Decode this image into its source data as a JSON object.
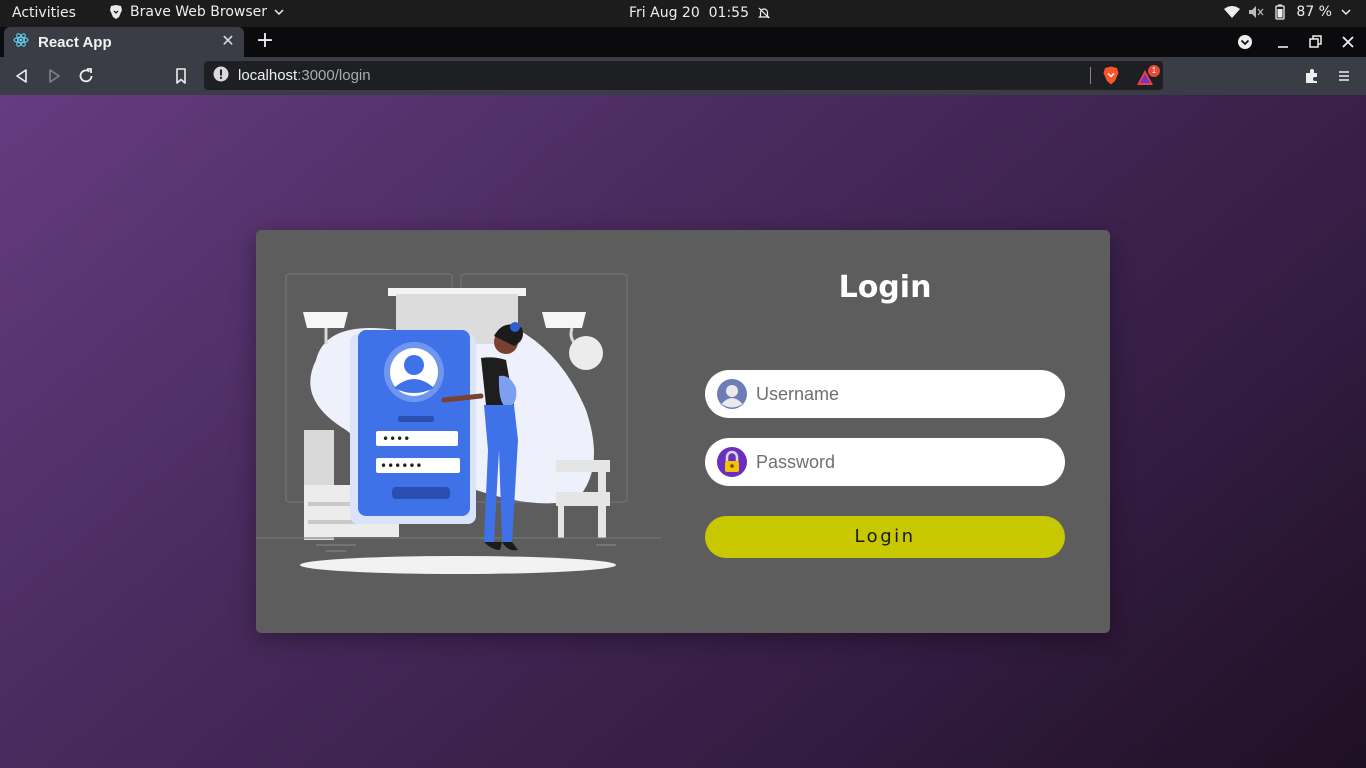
{
  "system_bar": {
    "activities": "Activities",
    "app_name": "Brave Web Browser",
    "clock": "Fri Aug 20  01:55",
    "battery": "87 %"
  },
  "browser": {
    "tab_title": "React App",
    "new_tab": "+",
    "tab_close": "✕",
    "url_host": "localhost",
    "url_path": ":3000/login",
    "rewards_badge": "1"
  },
  "login_card": {
    "title": "Login",
    "username_placeholder": "Username",
    "password_placeholder": "Password",
    "submit_label": "Login",
    "pin_dots": "••••",
    "password_dots": "••••••"
  },
  "colors": {
    "page_gradient_start": "#643c80",
    "page_gradient_end": "#1e1024",
    "card_background": "#5d5d5d",
    "button_background": "#c8c800",
    "illustration_blue": "#3f72e8"
  },
  "icons": {
    "system": [
      "brave-lion-icon",
      "chevron-down-icon",
      "notification-bell-off-icon",
      "wifi-icon",
      "volume-muted-icon",
      "battery-icon",
      "chevron-down-icon"
    ],
    "browser": [
      "react-icon",
      "close-icon",
      "plus-icon",
      "tab-search-icon",
      "minimize-icon",
      "restore-icon",
      "close-icon",
      "back-icon",
      "forward-icon",
      "reload-icon",
      "bookmark-icon",
      "info-icon",
      "brave-shields-icon",
      "brave-rewards-icon",
      "extensions-icon",
      "menu-icon"
    ],
    "form": [
      "user-avatar-icon",
      "padlock-icon"
    ]
  }
}
